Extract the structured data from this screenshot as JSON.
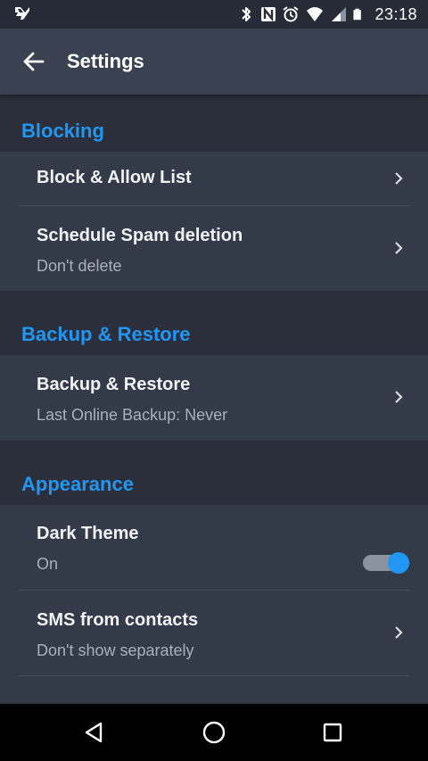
{
  "status_bar": {
    "time": "23:18",
    "icons": [
      "app-notification-icon",
      "bluetooth-icon",
      "nfc-icon",
      "alarm-icon",
      "wifi-icon",
      "cell-signal-icon",
      "battery-icon"
    ]
  },
  "app_bar": {
    "title": "Settings",
    "back_icon": "arrow-left-icon"
  },
  "sections": {
    "blocking": {
      "title": "Blocking",
      "items": [
        {
          "title": "Block & Allow List"
        },
        {
          "title": "Schedule Spam deletion",
          "subtitle": "Don't delete"
        }
      ]
    },
    "backup": {
      "title": "Backup & Restore",
      "items": [
        {
          "title": "Backup & Restore",
          "subtitle": "Last Online Backup: Never"
        }
      ]
    },
    "appearance": {
      "title": "Appearance",
      "items": [
        {
          "title": "Dark Theme",
          "subtitle": "On",
          "toggle_on": true
        },
        {
          "title": "SMS from contacts",
          "subtitle": "Don't show separately"
        }
      ]
    }
  },
  "nav_bar": {
    "icons": [
      "back-triangle-icon",
      "home-circle-icon",
      "recents-square-icon"
    ]
  },
  "colors": {
    "accent": "#2196f3",
    "background": "#2a2f3b",
    "card": "#333a48",
    "app_bar": "#3a4252"
  }
}
